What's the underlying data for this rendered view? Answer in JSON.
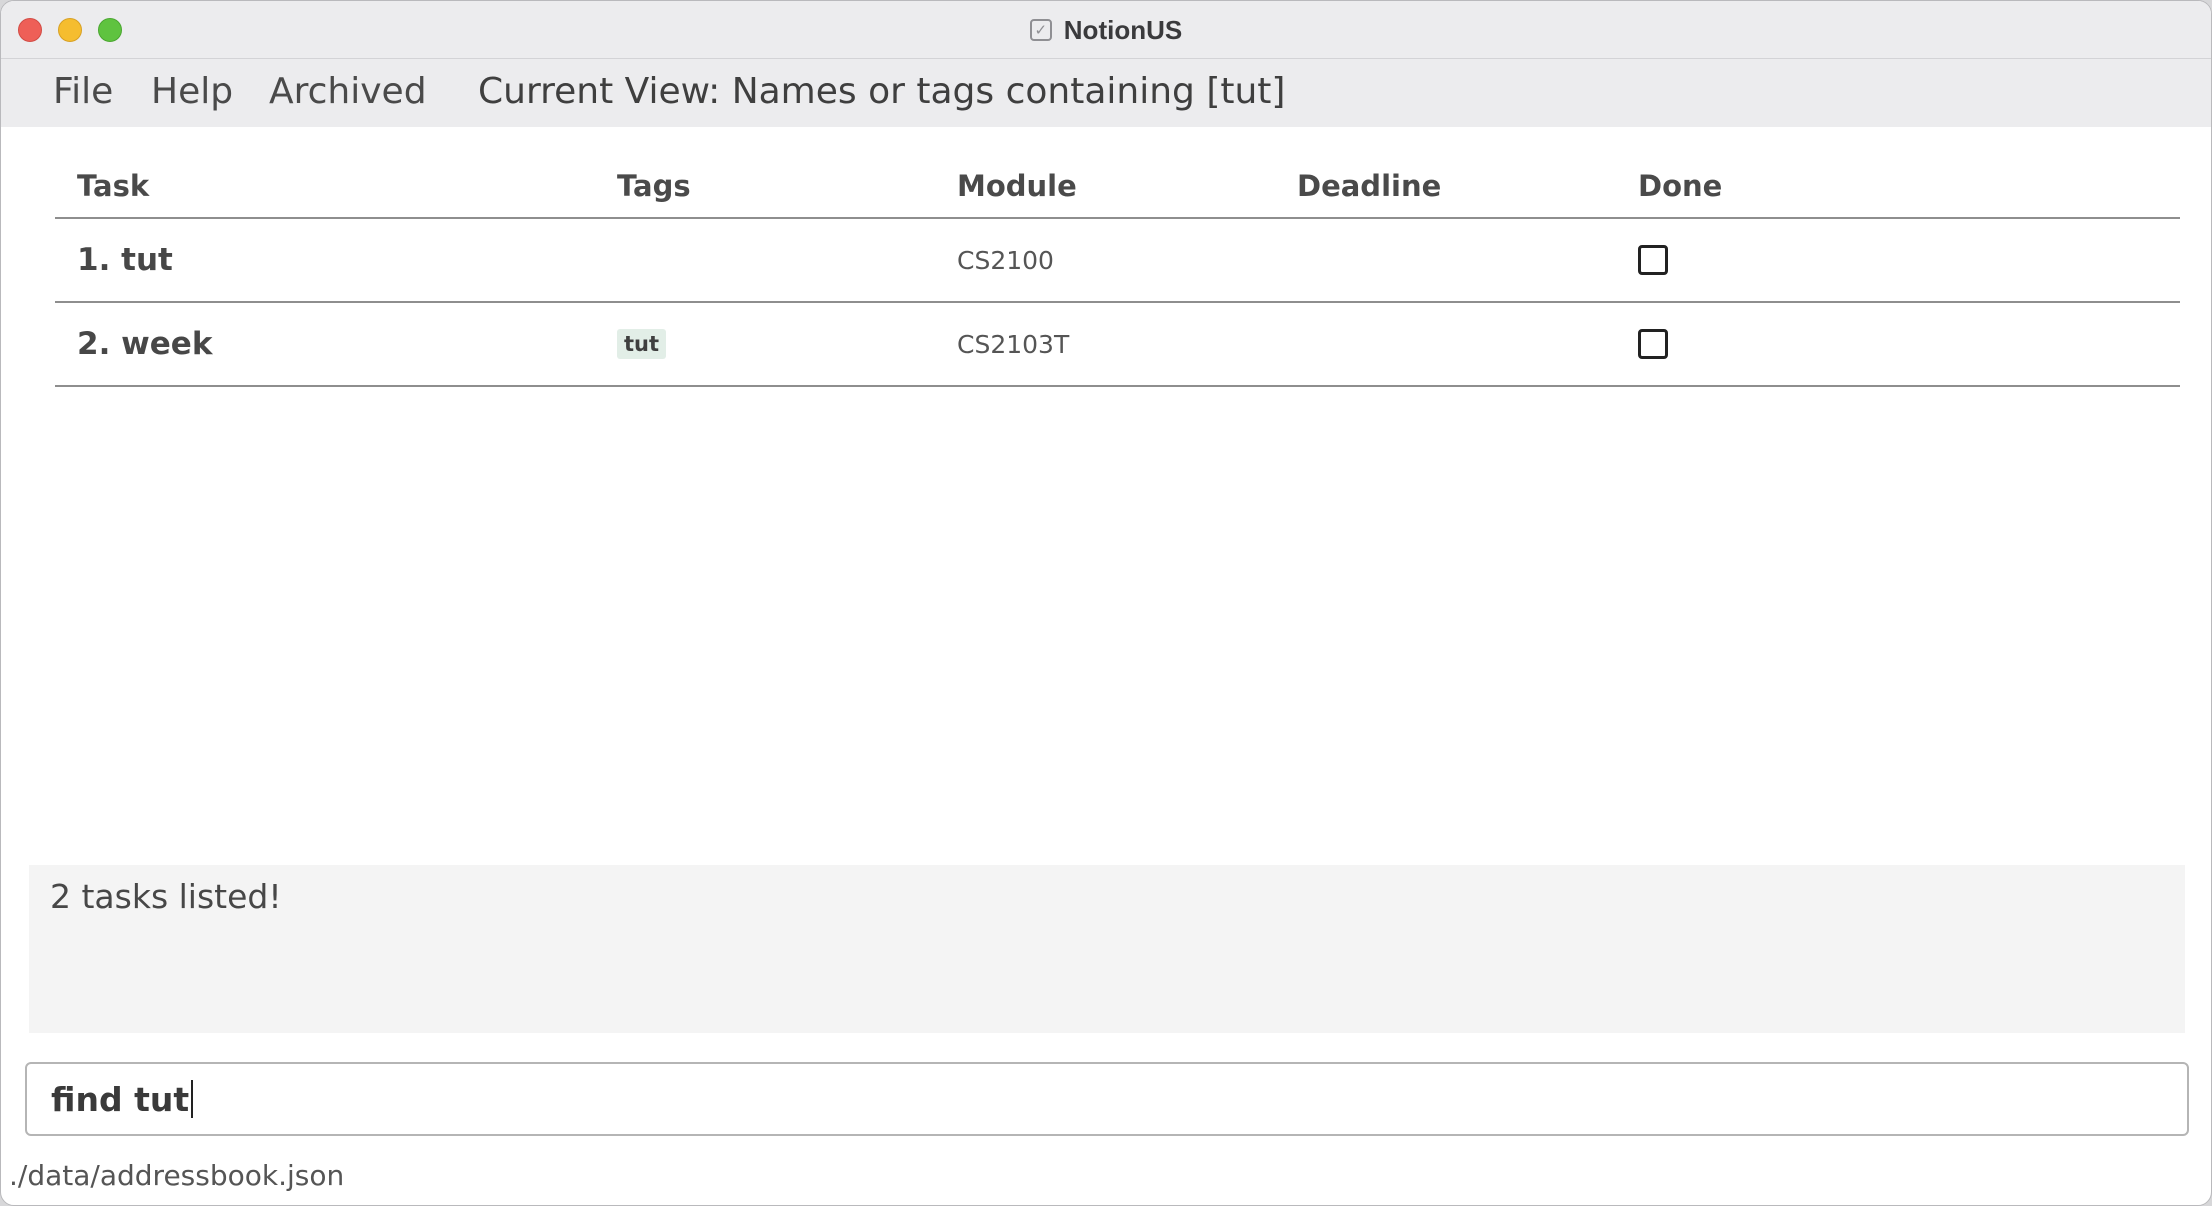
{
  "window": {
    "title": "NotionUS",
    "title_icon": "checkbox-icon"
  },
  "menu": {
    "file": "File",
    "help": "Help",
    "archived": "Archived"
  },
  "current_view": "Current View: Names or tags containing [tut]",
  "table": {
    "headers": {
      "task": "Task",
      "tags": "Tags",
      "module": "Module",
      "deadline": "Deadline",
      "done": "Done"
    },
    "rows": [
      {
        "task": "1. tut",
        "tags": [],
        "module": "CS2100",
        "deadline": "",
        "done": false
      },
      {
        "task": "2. week",
        "tags": [
          "tut"
        ],
        "module": "CS2103T",
        "deadline": "",
        "done": false
      }
    ]
  },
  "result": {
    "message": "2 tasks listed!"
  },
  "command": {
    "value": "find tut"
  },
  "status": {
    "file_path": "./data/addressbook.json"
  },
  "colors": {
    "tag_background": "#e2eee7",
    "close": "#ee5f57",
    "minimize": "#f5bd2f",
    "maximize": "#5fc33f"
  }
}
